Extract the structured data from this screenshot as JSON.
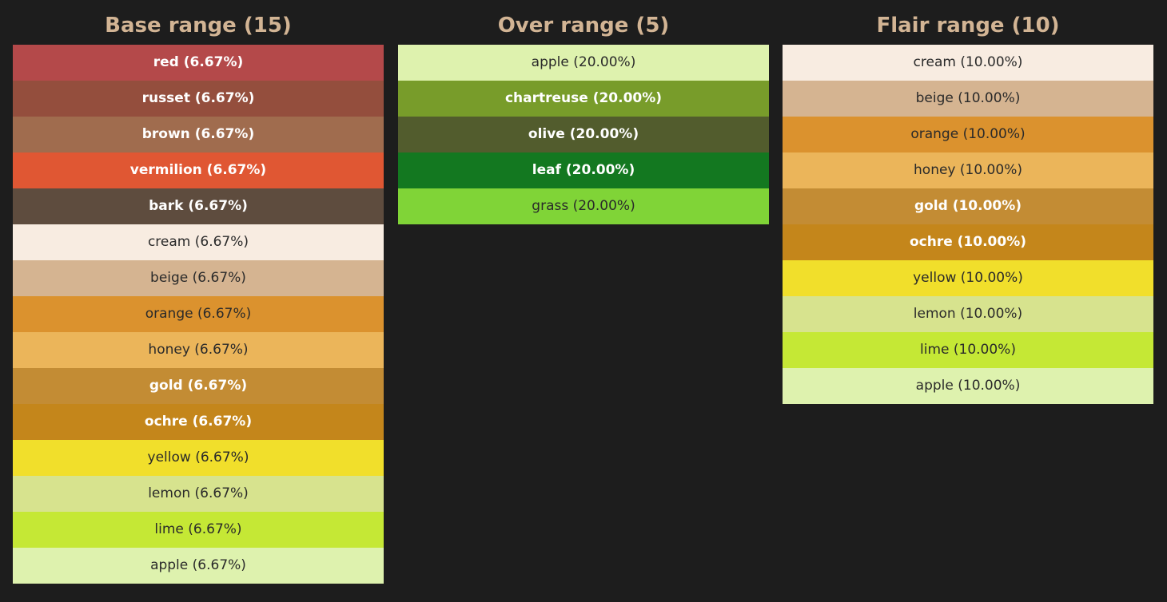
{
  "colors": {
    "background": "#1d1d1d",
    "title": "#d2b494"
  },
  "columns": [
    {
      "id": "base",
      "title": "Base range (15)",
      "swatches": [
        {
          "label": "red (6.67%)",
          "color": "#b4494a",
          "tone": "dark"
        },
        {
          "label": "russet (6.67%)",
          "color": "#944e3d",
          "tone": "dark"
        },
        {
          "label": "brown (6.67%)",
          "color": "#a06c4e",
          "tone": "dark"
        },
        {
          "label": "vermilion (6.67%)",
          "color": "#e05733",
          "tone": "dark"
        },
        {
          "label": "bark (6.67%)",
          "color": "#5e4c3e",
          "tone": "dark"
        },
        {
          "label": "cream (6.67%)",
          "color": "#f8ece1",
          "tone": "light"
        },
        {
          "label": "beige (6.67%)",
          "color": "#d5b491",
          "tone": "light"
        },
        {
          "label": "orange (6.67%)",
          "color": "#db922e",
          "tone": "light"
        },
        {
          "label": "honey (6.67%)",
          "color": "#ebb55a",
          "tone": "light"
        },
        {
          "label": "gold (6.67%)",
          "color": "#c38c34",
          "tone": "dark"
        },
        {
          "label": "ochre (6.67%)",
          "color": "#c4861b",
          "tone": "dark"
        },
        {
          "label": "yellow (6.67%)",
          "color": "#f1df2b",
          "tone": "light"
        },
        {
          "label": "lemon (6.67%)",
          "color": "#d7e38e",
          "tone": "light"
        },
        {
          "label": "lime (6.67%)",
          "color": "#c5e835",
          "tone": "light"
        },
        {
          "label": "apple (6.67%)",
          "color": "#def2ae",
          "tone": "light"
        }
      ]
    },
    {
      "id": "over",
      "title": "Over range (5)",
      "swatches": [
        {
          "label": "apple (20.00%)",
          "color": "#def2ae",
          "tone": "light"
        },
        {
          "label": "chartreuse (20.00%)",
          "color": "#789c2a",
          "tone": "dark"
        },
        {
          "label": "olive (20.00%)",
          "color": "#525c2d",
          "tone": "dark"
        },
        {
          "label": "leaf (20.00%)",
          "color": "#137820",
          "tone": "dark"
        },
        {
          "label": "grass (20.00%)",
          "color": "#80d437",
          "tone": "light"
        }
      ]
    },
    {
      "id": "flair",
      "title": "Flair range (10)",
      "swatches": [
        {
          "label": "cream (10.00%)",
          "color": "#f8ece1",
          "tone": "light"
        },
        {
          "label": "beige (10.00%)",
          "color": "#d5b491",
          "tone": "light"
        },
        {
          "label": "orange (10.00%)",
          "color": "#db922e",
          "tone": "light"
        },
        {
          "label": "honey (10.00%)",
          "color": "#ebb55a",
          "tone": "light"
        },
        {
          "label": "gold (10.00%)",
          "color": "#c38c34",
          "tone": "dark"
        },
        {
          "label": "ochre (10.00%)",
          "color": "#c4861b",
          "tone": "dark"
        },
        {
          "label": "yellow (10.00%)",
          "color": "#f1df2b",
          "tone": "light"
        },
        {
          "label": "lemon (10.00%)",
          "color": "#d7e38e",
          "tone": "light"
        },
        {
          "label": "lime (10.00%)",
          "color": "#c5e835",
          "tone": "light"
        },
        {
          "label": "apple (10.00%)",
          "color": "#def2ae",
          "tone": "light"
        }
      ]
    }
  ]
}
